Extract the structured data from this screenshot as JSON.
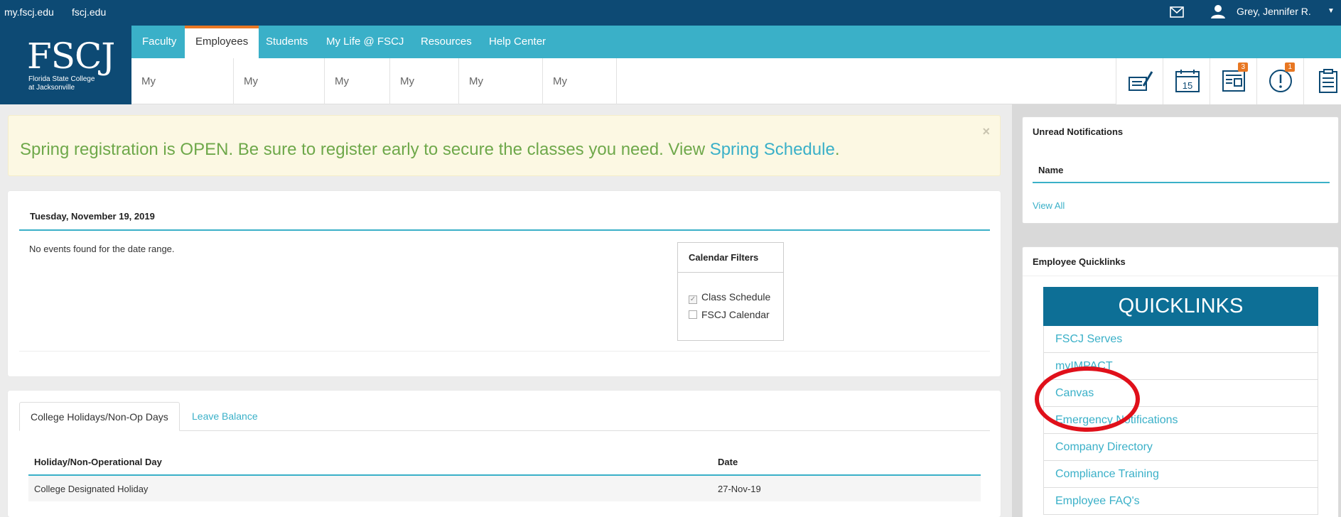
{
  "topbar": {
    "link1": "my.fscj.edu",
    "link2": "fscj.edu",
    "user_name": "Grey, Jennifer R.",
    "mail_icon": "envelope-icon",
    "user_icon": "person-icon"
  },
  "logo": {
    "mark": "FSCJ",
    "line1": "Florida State College",
    "line2": "at Jacksonville"
  },
  "mainnav": {
    "items": [
      "Faculty",
      "Employees",
      "Students",
      "My Life @ FSCJ",
      "Resources",
      "Help Center"
    ],
    "active": "Employees"
  },
  "subnav": {
    "items": [
      "My Requisitions",
      "My Expenses",
      "My Pay",
      "My Time",
      "My Benefits",
      "My Career"
    ]
  },
  "tools": {
    "notes_icon": "pen-notepad-icon",
    "calendar_icon": "calendar-icon",
    "calendar_day": "15",
    "news_icon": "newspaper-icon",
    "news_badge": "3",
    "alert_icon": "alert-circle-icon",
    "alert_badge": "1",
    "clipboard_icon": "clipboard-icon"
  },
  "alert": {
    "text": "Spring registration is OPEN. Be sure to register early to secure the classes you need. View ",
    "link": "Spring Schedule",
    "end": ".",
    "close": "×"
  },
  "calendar": {
    "date": "Tuesday, November 19, 2019",
    "no_events": "No events found for the date range.",
    "filters_title": "Calendar Filters",
    "filter1": "Class Schedule",
    "filter1_checked": true,
    "filter2": "FSCJ Calendar",
    "filter2_checked": false
  },
  "holidays": {
    "tab_active": "College Holidays/Non-Op Days",
    "tab_other": "Leave Balance",
    "col1": "Holiday/Non-Operational Day",
    "col2": "Date",
    "row1_name": "College Designated Holiday",
    "row1_date": "27-Nov-19"
  },
  "notifications": {
    "title": "Unread Notifications",
    "col": "Name",
    "view_all": "View All"
  },
  "quicklinks": {
    "panel_title": "Employee Quicklinks",
    "header": "QUICKLINKS",
    "items": [
      "FSCJ Serves",
      "myIMPACT",
      "Canvas",
      "Emergency Notifications",
      "Company Directory",
      "Compliance Training",
      "Employee FAQ's"
    ]
  },
  "colors": {
    "navy": "#0d4a74",
    "teal": "#3ab0c8",
    "accent": "#e87722",
    "annotation": "#e0101a"
  }
}
